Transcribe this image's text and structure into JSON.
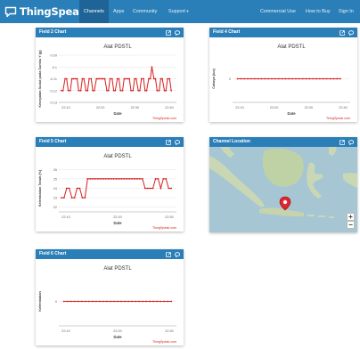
{
  "nav": {
    "brand": "ThingSpeak",
    "tm": "™",
    "items": [
      "Channels",
      "Apps",
      "Community",
      "Support"
    ],
    "support_caret": "▾",
    "right_items": [
      "Commercial Use",
      "How to Buy",
      "Sign In"
    ]
  },
  "panels": {
    "field2": {
      "title": "Field 2 Chart"
    },
    "field4": {
      "title": "Field 4 Chart"
    },
    "field5": {
      "title": "Field 5 Chart"
    },
    "location": {
      "title": "Channel Location"
    },
    "field6": {
      "title": "Field 6 Chart"
    }
  },
  "map": {
    "zoom_in": "+",
    "zoom_out": "−"
  },
  "chart_data": [
    {
      "id": "field2",
      "type": "line",
      "title": "Alat PDSTL",
      "xlabel": "Date",
      "ylabel": "Kecepatan Sudut pada Sumbu Y (g)",
      "credit": "ThingSpeak.com",
      "x_ticks": [
        "22:10",
        "22:20",
        "22:30",
        "22:40"
      ],
      "y_ticks": [
        "-0.09",
        "-0.1",
        "-0.11",
        "-0.12",
        "-0.13"
      ],
      "ylim": [
        -0.13,
        -0.09
      ],
      "x": [
        0,
        0.6,
        1.4,
        2,
        2.6,
        3.4,
        4,
        4.6,
        5.4,
        6,
        6.6,
        7.4,
        8,
        8.6,
        9.4,
        10,
        10.6,
        11.4,
        12,
        12.6,
        13.4,
        14,
        14.6,
        15.4,
        16,
        16.6,
        17.4,
        18,
        18.6,
        19.4,
        20,
        20.6,
        21.4,
        22,
        22.6,
        23.4,
        24,
        24.6,
        25.4,
        26,
        26.6,
        27.4,
        28,
        28.6,
        29.4,
        30,
        30.6,
        31.4,
        32,
        32.6,
        33.4,
        34,
        34.6,
        35.4,
        36,
        36.6,
        37.4,
        38,
        38.6,
        39.4,
        40,
        40.6,
        41.4,
        42
      ],
      "y": [
        -0.12,
        -0.12,
        -0.11,
        -0.11,
        -0.12,
        -0.12,
        -0.11,
        -0.11,
        -0.11,
        -0.11,
        -0.12,
        -0.12,
        -0.11,
        -0.11,
        -0.12,
        -0.12,
        -0.11,
        -0.11,
        -0.12,
        -0.12,
        -0.11,
        -0.11,
        -0.11,
        -0.11,
        -0.11,
        -0.11,
        -0.12,
        -0.12,
        -0.11,
        -0.11,
        -0.12,
        -0.12,
        -0.11,
        -0.11,
        -0.12,
        -0.12,
        -0.11,
        -0.11,
        -0.11,
        -0.11,
        -0.12,
        -0.12,
        -0.11,
        -0.11,
        -0.12,
        -0.12,
        -0.11,
        -0.11,
        -0.12,
        -0.12,
        -0.11,
        -0.11,
        -0.1,
        -0.11,
        -0.11,
        -0.12,
        -0.12,
        -0.11,
        -0.11,
        -0.12,
        -0.12,
        -0.11,
        -0.11,
        -0.12
      ],
      "xlim": [
        -1,
        44
      ],
      "color": "#d62020"
    },
    {
      "id": "field4",
      "type": "line",
      "title": "Alat PDSTL",
      "xlabel": "Date",
      "ylabel": "Cahaya (lux)",
      "credit": "ThingSpeak.com",
      "x_ticks": [
        "22:10",
        "22:20",
        "22:30",
        "22:40"
      ],
      "y_ticks": [
        "0"
      ],
      "ylim": [
        -1,
        1
      ],
      "x": [
        0,
        1.4,
        2.8,
        4.2,
        5.6,
        7,
        8.4,
        9.8,
        11.2,
        12.6,
        14,
        15.4,
        16.8,
        18.2,
        19.6,
        21,
        22.4,
        23.8,
        25.2,
        26.6,
        28,
        29.4,
        30.8,
        32.2,
        33.6,
        35,
        36.4,
        37.8,
        39.2,
        40.6,
        42
      ],
      "y": [
        0,
        0,
        0,
        0,
        0,
        0,
        0,
        0,
        0,
        0,
        0,
        0,
        0,
        0,
        0,
        0,
        0,
        0,
        0,
        0,
        0,
        0,
        0,
        0,
        0,
        0,
        0,
        0,
        0,
        0,
        0
      ],
      "xlim": [
        -2,
        46
      ],
      "color": "#d62020"
    },
    {
      "id": "field5",
      "type": "line",
      "title": "Alat PDSTL",
      "xlabel": "Date",
      "ylabel": "Kelembaban Tanah (%)",
      "credit": "ThingSpeak.com",
      "x_ticks": [
        "22:10",
        "22:20",
        "22:30"
      ],
      "y_ticks": [
        "26",
        "25",
        "24",
        "23",
        "22"
      ],
      "ylim": [
        21.5,
        26.5
      ],
      "x": [
        0,
        1,
        2,
        3,
        4,
        5,
        6,
        7,
        8,
        9,
        10,
        11,
        12,
        13,
        14,
        15,
        16,
        17,
        18,
        19,
        20,
        21,
        22,
        23,
        24,
        25,
        26,
        27,
        28,
        29,
        30,
        31,
        32,
        33,
        34,
        35,
        36,
        37,
        38,
        39,
        40,
        41,
        42
      ],
      "y": [
        23,
        23,
        24,
        24,
        23,
        23,
        24,
        24,
        23,
        23,
        25,
        25,
        25,
        25,
        25,
        25,
        25,
        25,
        25,
        25,
        25,
        25,
        25,
        25,
        25,
        25,
        25,
        25,
        25,
        25,
        25,
        25,
        24,
        24,
        24,
        24,
        25,
        25,
        24,
        25,
        25,
        24,
        24
      ],
      "xlim": [
        -1,
        44
      ],
      "color": "#d62020"
    },
    {
      "id": "field6",
      "type": "line",
      "title": "Alat PDSTL",
      "xlabel": "Date",
      "ylabel": "Kelembaban",
      "credit": "ThingSpeak.com",
      "x_ticks": [
        "22:10",
        "22:20",
        "22:30"
      ],
      "y_ticks": [
        "0"
      ],
      "ylim": [
        -1,
        1
      ],
      "x": [
        0,
        1.4,
        2.8,
        4.2,
        5.6,
        7,
        8.4,
        9.8,
        11.2,
        12.6,
        14,
        15.4,
        16.8,
        18.2,
        19.6,
        21,
        22.4,
        23.8,
        25.2,
        26.6,
        28,
        29.4,
        30.8,
        32.2,
        33.6,
        35,
        36.4,
        37.8,
        39.2,
        40.6,
        42
      ],
      "y": [
        0,
        0,
        0,
        0,
        0,
        0,
        0,
        0,
        0,
        0,
        0,
        0,
        0,
        0,
        0,
        0,
        0,
        0,
        0,
        0,
        0,
        0,
        0,
        0,
        0,
        0,
        0,
        0,
        0,
        0,
        0
      ],
      "xlim": [
        -2,
        44
      ],
      "color": "#d62020"
    }
  ]
}
